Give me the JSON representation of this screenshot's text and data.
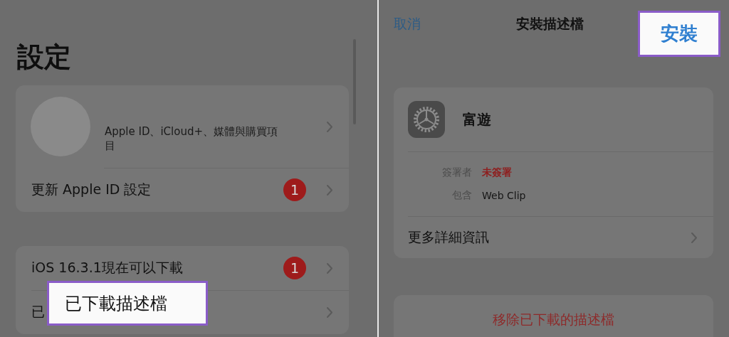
{
  "settings": {
    "title": "設定",
    "profile": {
      "subtitle": "Apple ID、iCloud+、媒體與購買項目"
    },
    "groups": [
      {
        "rows": [
          {
            "label": "更新 Apple ID 設定",
            "badge": "1"
          }
        ]
      },
      {
        "rows": [
          {
            "label": "iOS 16.3.1現在可以下載",
            "badge": "1"
          },
          {
            "label": "已"
          }
        ]
      }
    ],
    "highlight": {
      "text": "已下載描述檔"
    }
  },
  "install_profile": {
    "cancel": "取消",
    "title": "安裝描述檔",
    "install": "安裝",
    "profile_name": "富遊",
    "details": [
      {
        "label": "簽署者",
        "value": "未簽署",
        "kind": "warning"
      },
      {
        "label": "包含",
        "value": "Web Clip",
        "kind": "plain"
      }
    ],
    "more": "更多詳細資訊",
    "remove": "移除已下載的描述檔"
  }
}
